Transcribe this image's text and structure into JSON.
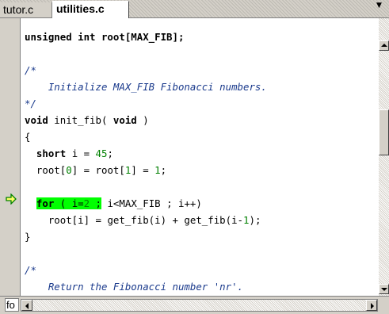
{
  "tabs": [
    {
      "label": "tutor.c",
      "active": false
    },
    {
      "label": "utilities.c",
      "active": true
    }
  ],
  "editor": {
    "lines": {
      "l1": "unsigned int root[MAX_FIB];",
      "l3": "/*",
      "l4": "    Initialize MAX_FIB Fibonacci numbers.",
      "l5": "*/",
      "l6_kw": "void",
      "l6_mid": " init_fib( ",
      "l6_kw2": "void",
      "l6_end": " )",
      "l7": "{",
      "l8_kw": "short",
      "l8_mid": " i = ",
      "l8_num": "45",
      "l8_end": ";",
      "l9_a": "root[",
      "l9_n1": "0",
      "l9_b": "] = root[",
      "l9_n2": "1",
      "l9_c": "] = ",
      "l9_n3": "1",
      "l9_d": ";",
      "l11_kw": "for",
      "l11_a": " ( i=",
      "l11_n": "2",
      "l11_b": " ;",
      "l11_rest": " i<MAX_FIB ; i++)",
      "l12_a": "root[i] = get_fib(i) + get_fib(i-",
      "l12_n": "1",
      "l12_b": ");",
      "l13": "}",
      "l15": "/*",
      "l16": "    Return the Fibonacci number 'nr'.",
      "l17": "*/"
    },
    "current_line_marker": "green-arrow"
  },
  "status": {
    "function_box": "fo"
  },
  "colors": {
    "keyword": "#000000",
    "number": "#008000",
    "comment": "#1a3a8c",
    "highlight": "#00ff00"
  }
}
